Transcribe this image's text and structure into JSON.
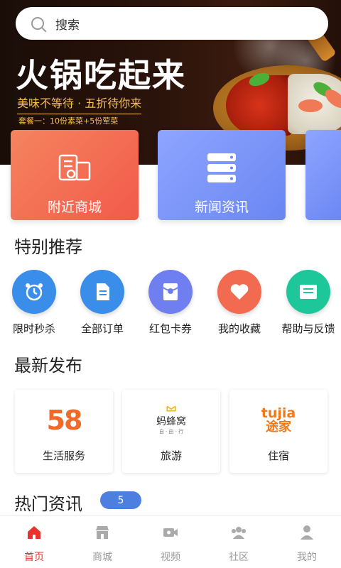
{
  "search": {
    "placeholder": "搜索",
    "icon": "search-icon"
  },
  "banner": {
    "title": "火锅吃起来",
    "subtitle": "美味不等待 · 五折待你来",
    "note": "套餐一：10份素菜+5份荤菜"
  },
  "big_cards": [
    {
      "label": "附近商城",
      "icon": "map-store-icon",
      "color": "#f25a4a"
    },
    {
      "label": "新闻资讯",
      "icon": "server-list-icon",
      "color": "#6a86f2"
    }
  ],
  "sections": {
    "special": "特别推荐",
    "latest": "最新发布",
    "hot": "热门资讯",
    "hot_count": "5"
  },
  "special_items": [
    {
      "label": "限时秒杀",
      "icon": "alarm-clock-icon",
      "color": "#3a8de8"
    },
    {
      "label": "全部订单",
      "icon": "document-icon",
      "color": "#3a8de8"
    },
    {
      "label": "红包卡券",
      "icon": "red-envelope-icon",
      "color": "#6f7ff0"
    },
    {
      "label": "我的收藏",
      "icon": "heart-icon",
      "color": "#f26a4f"
    },
    {
      "label": "帮助与反馈",
      "icon": "mail-icon",
      "color": "#1ec79a"
    }
  ],
  "latest_items": [
    {
      "label": "生活服务",
      "logo_text": "58"
    },
    {
      "label": "旅游",
      "logo_text": "蚂蜂窝",
      "logo_sub": "自 · 由 · 行"
    },
    {
      "label": "住宿",
      "logo_text": "tujia",
      "logo_sub": "途家"
    }
  ],
  "tabs": [
    {
      "label": "首页",
      "icon": "home-icon",
      "active": true
    },
    {
      "label": "商城",
      "icon": "store-icon",
      "active": false
    },
    {
      "label": "视频",
      "icon": "video-icon",
      "active": false
    },
    {
      "label": "社区",
      "icon": "community-icon",
      "active": false
    },
    {
      "label": "我的",
      "icon": "user-icon",
      "active": false
    }
  ],
  "colors": {
    "accent": "#e8342e",
    "inactive": "#999999",
    "banner_text": "#f6c04a"
  }
}
